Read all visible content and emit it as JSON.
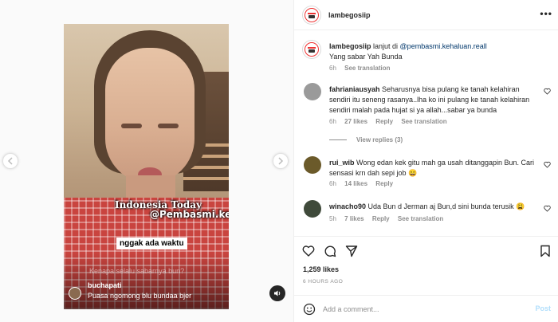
{
  "post": {
    "username": "lambegosiip",
    "more_label": "•••"
  },
  "video_overlay": {
    "watermark_title": "Indonesia Today",
    "watermark_handle": "@Pembasmi.kehaluan.reall",
    "caption_box": "nggak ada waktu",
    "faded_question": "Kenapa selalu sabarnya bun?",
    "live_user": "buchapati",
    "live_message": "Puasa ngomong blu bundaa bjer"
  },
  "caption": {
    "username": "lambegosiip",
    "text_before": " lanjut di ",
    "mention": "@pembasmi.kehaluan.reall",
    "line2": "Yang sabar Yah Bunda",
    "time": "6h",
    "see_translation": "See translation"
  },
  "comments": [
    {
      "username": "fahrianiausyah",
      "text": " Seharusnya bisa pulang ke tanah kelahiran sendiri itu seneng rasanya..lha ko ini pulang ke tanah kelahiran sendiri malah pada hujat si ya allah...sabar ya bunda",
      "time": "6h",
      "likes": "27 likes",
      "reply": "Reply",
      "see_translation": "See translation",
      "view_replies": "View replies (3)"
    },
    {
      "username": "rui_wib",
      "text": " Wong edan kek gitu mah ga usah ditanggapin Bun. Cari sensasi krn dah sepi job 😄",
      "time": "6h",
      "likes": "14 likes",
      "reply": "Reply"
    },
    {
      "username": "winacho90",
      "text": " Uda Bun d Jerman aj Bun,d sini bunda terusik 😩",
      "time": "5h",
      "likes": "7 likes",
      "reply": "Reply",
      "see_translation": "See translation"
    }
  ],
  "stats": {
    "likes": "1,259 likes",
    "ago": "6 HOURS AGO"
  },
  "add_comment": {
    "placeholder": "Add a comment...",
    "post_label": "Post"
  },
  "icons": [
    "more-icon",
    "heart-icon",
    "comment-icon",
    "share-icon",
    "bookmark-icon",
    "emoji-icon",
    "sound-icon",
    "chevron-left-icon",
    "chevron-right-icon"
  ],
  "colors": {
    "link": "#00376b",
    "meta": "#8e8e8e",
    "post_disabled": "#b2dffc",
    "divider": "#efefef"
  }
}
